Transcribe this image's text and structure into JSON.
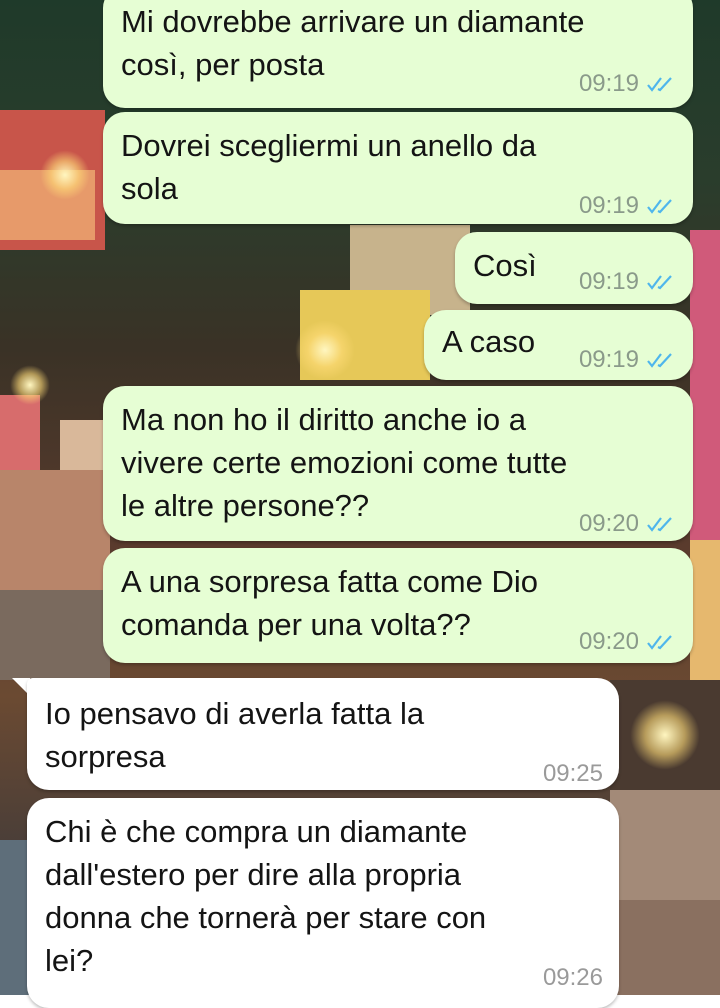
{
  "colors": {
    "outgoing_bubble": "#e6fed4",
    "incoming_bubble": "#ffffff",
    "read_ticks": "#4fb6ec",
    "timestamp": "#8a9a8a"
  },
  "messages": [
    {
      "direction": "out",
      "text": "Mi dovrebbe arrivare un diamante\ncosì, per posta",
      "time": "09:19",
      "status": "read-ticks-icon"
    },
    {
      "direction": "out",
      "text": "Dovrei scegliermi un anello da\nsola",
      "time": "09:19",
      "status": "read-ticks-icon"
    },
    {
      "direction": "out",
      "text": "Così",
      "time": "09:19",
      "status": "read-ticks-icon"
    },
    {
      "direction": "out",
      "text": "A caso",
      "time": "09:19",
      "status": "read-ticks-icon"
    },
    {
      "direction": "out",
      "text": "Ma non ho il diritto anche io a\nvivere certe emozioni come tutte\nle altre persone??",
      "time": "09:20",
      "status": "read-ticks-icon"
    },
    {
      "direction": "out",
      "text": "A una sorpresa fatta come Dio\ncomanda per una volta??",
      "time": "09:20",
      "status": "read-ticks-icon"
    },
    {
      "direction": "in",
      "text": "Io pensavo di averla fatta la\nsorpresa",
      "time": "09:25"
    },
    {
      "direction": "in",
      "text": "Chi è che compra un diamante\ndall'estero per dire alla propria\ndonna che tornerà per stare con\nlei?",
      "time": "09:26"
    }
  ]
}
